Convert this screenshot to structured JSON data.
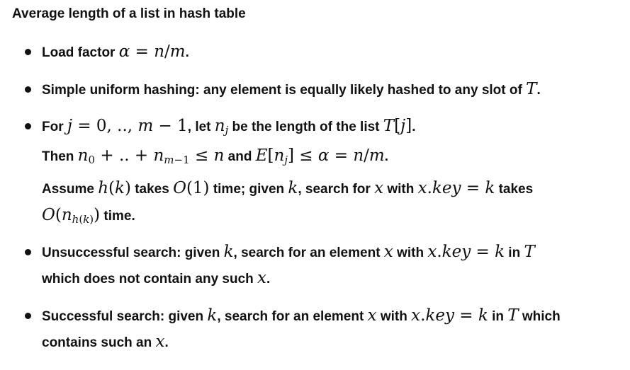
{
  "title": "Average length of a list in hash table",
  "bullets": {
    "load_factor": {
      "prefix": "Load factor ",
      "suffix": "."
    },
    "uniform": {
      "prefix": "Simple uniform hashing: any element is equally likely hashed to any slot of ",
      "suffix": "."
    },
    "for_j": {
      "l1_a": "For ",
      "l1_b": ", let ",
      "l1_c": " be the length of the list ",
      "l1_d": ".",
      "l2_a": "Then ",
      "l2_b": " and ",
      "l2_c": ".",
      "l3_a": "Assume ",
      "l3_b": " takes ",
      "l3_c": " time; given ",
      "l3_d": ", search for ",
      "l3_e": " with ",
      "l3_f": " takes",
      "l4_a": " time."
    },
    "unsuccessful": {
      "l1_a": "Unsuccessful search: given ",
      "l1_b": ", search for an element ",
      "l1_c": " with ",
      "l1_d": " in ",
      "l2_a": "which does not contain any such ",
      "l2_b": "."
    },
    "successful": {
      "l1_a": "Successful search: given ",
      "l1_b": ", search for an element ",
      "l1_c": " with ",
      "l1_d": " in ",
      "l1_e": " which",
      "l2_a": "contains such an ",
      "l2_b": "."
    }
  }
}
